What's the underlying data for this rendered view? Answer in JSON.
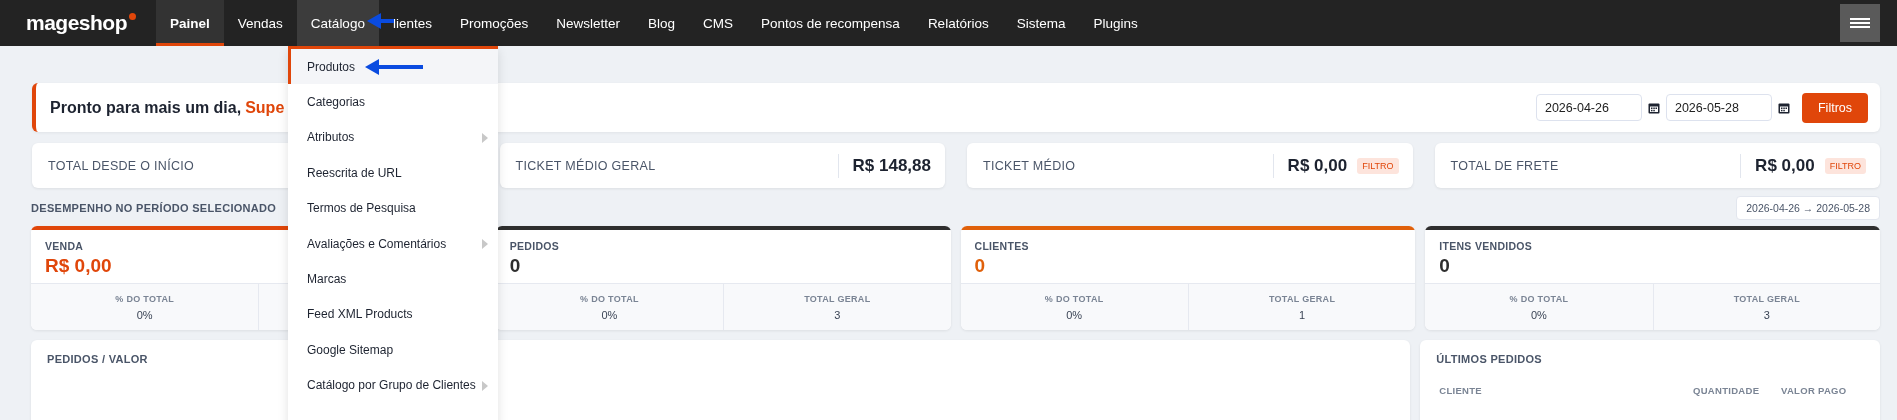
{
  "nav": {
    "logo": "mageshop",
    "items": [
      {
        "label": "Painel",
        "selected": true,
        "open": false
      },
      {
        "label": "Vendas",
        "selected": false,
        "open": false
      },
      {
        "label": "Catálogo",
        "selected": false,
        "open": true
      },
      {
        "label": "lientes",
        "selected": false,
        "open": false
      },
      {
        "label": "Promoções",
        "selected": false,
        "open": false
      },
      {
        "label": "Newsletter",
        "selected": false,
        "open": false
      },
      {
        "label": "Blog",
        "selected": false,
        "open": false
      },
      {
        "label": "CMS",
        "selected": false,
        "open": false
      },
      {
        "label": "Pontos de recompensa",
        "selected": false,
        "open": false
      },
      {
        "label": "Relatórios",
        "selected": false,
        "open": false
      },
      {
        "label": "Sistema",
        "selected": false,
        "open": false
      },
      {
        "label": "Plugins",
        "selected": false,
        "open": false
      }
    ]
  },
  "dropdown": {
    "items": [
      {
        "label": "Produtos",
        "selected": true,
        "submenu": false
      },
      {
        "label": "Categorias",
        "selected": false,
        "submenu": false
      },
      {
        "label": "Atributos",
        "selected": false,
        "submenu": true
      },
      {
        "label": "Reescrita de URL",
        "selected": false,
        "submenu": false
      },
      {
        "label": "Termos de Pesquisa",
        "selected": false,
        "submenu": false
      },
      {
        "label": "Avaliações e Comentários",
        "selected": false,
        "submenu": true
      },
      {
        "label": "Marcas",
        "selected": false,
        "submenu": false
      },
      {
        "label": "Feed XML Products",
        "selected": false,
        "submenu": false
      },
      {
        "label": "Google Sitemap",
        "selected": false,
        "submenu": false
      },
      {
        "label": "Catálogo por Grupo de Clientes",
        "selected": false,
        "submenu": true
      }
    ]
  },
  "greeting": {
    "text": "Pronto para mais um dia,",
    "name": "Supe"
  },
  "filters": {
    "start": "2026-04-26",
    "end": "2026-05-28",
    "button": "Filtros"
  },
  "totals": [
    {
      "label": "TOTAL DESDE O INÍCIO"
    },
    {
      "label": "TICKET MÉDIO GERAL",
      "value": "R$ 148,88"
    },
    {
      "label": "TICKET MÉDIO",
      "value": "R$ 0,00",
      "badge": "FILTRO"
    },
    {
      "label": "TOTAL DE FRETE",
      "value": "R$ 0,00",
      "badge": "FILTRO"
    }
  ],
  "performance": {
    "title": "DESEMPENHO NO PERÍODO SELECIONADO",
    "range": "2026-04-26 → 2026-05-28",
    "cards": [
      {
        "label": "VENDA",
        "value": "R$ 0,00",
        "color": "#e0460a",
        "stats": [
          {
            "label": "% DO TOTAL",
            "value": "0%"
          }
        ]
      },
      {
        "label": "PEDIDOS",
        "value": "0",
        "color": "#2e2e2e",
        "stats": [
          {
            "label": "% DO TOTAL",
            "value": "0%"
          },
          {
            "label": "TOTAL GERAL",
            "value": "3"
          }
        ]
      },
      {
        "label": "CLIENTES",
        "value": "0",
        "color": "#e0600a",
        "stats": [
          {
            "label": "% DO TOTAL",
            "value": "0%"
          },
          {
            "label": "TOTAL GERAL",
            "value": "1"
          }
        ]
      },
      {
        "label": "ITENS VENDIDOS",
        "value": "0",
        "color": "#2e2e2e",
        "stats": [
          {
            "label": "% DO TOTAL",
            "value": "0%"
          },
          {
            "label": "TOTAL GERAL",
            "value": "3"
          }
        ]
      }
    ]
  },
  "orders_chart": {
    "title": "PEDIDOS / VALOR"
  },
  "recent_orders": {
    "title": "ÚLTIMOS PEDIDOS",
    "columns": [
      "CLIENTE",
      "QUANTIDADE",
      "VALOR PAGO"
    ]
  }
}
